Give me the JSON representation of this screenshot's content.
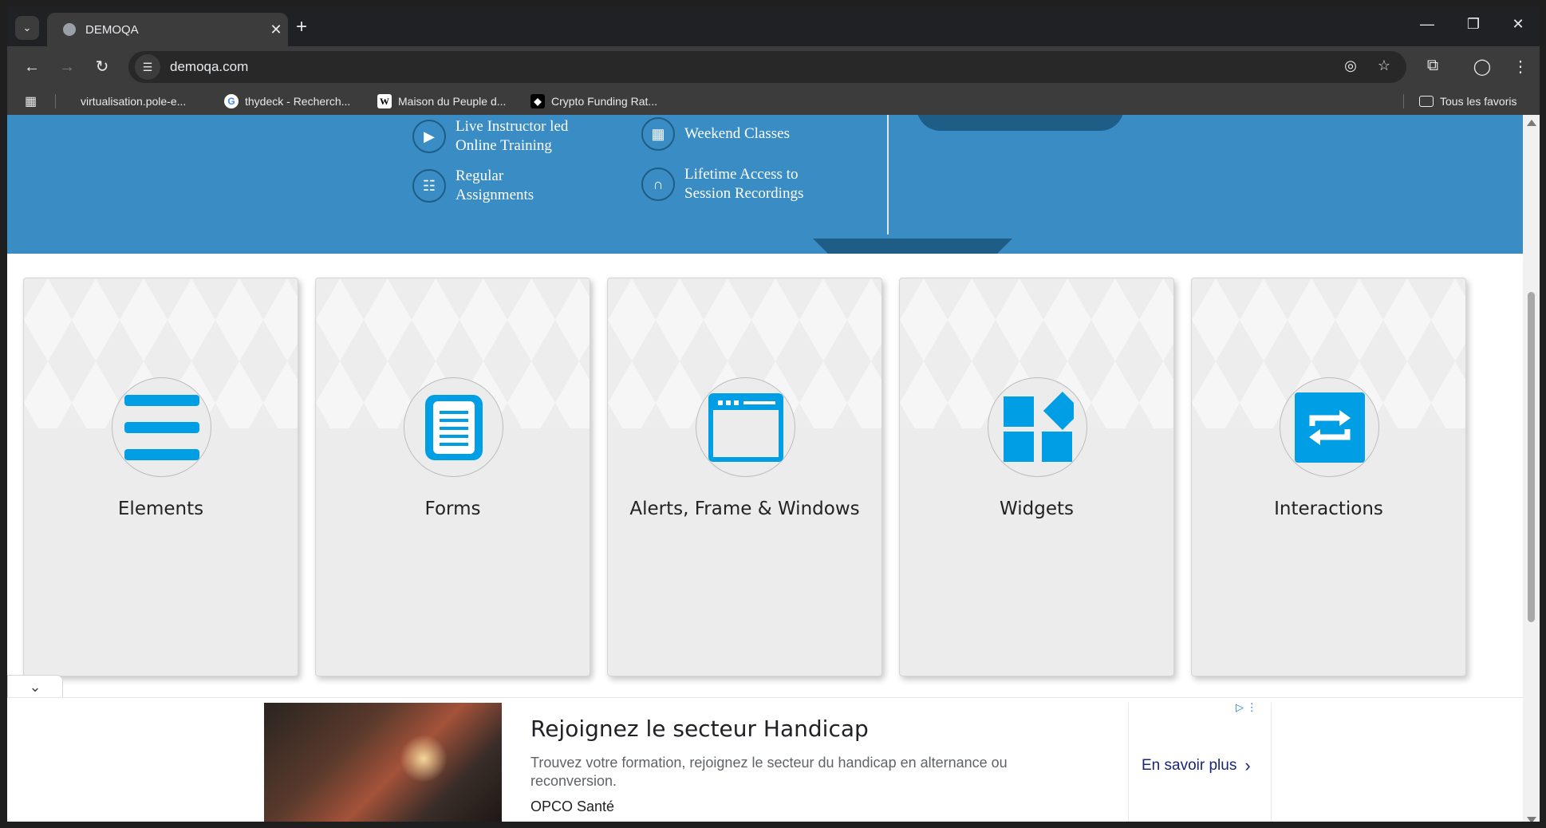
{
  "browser": {
    "tab_title": "DEMOQA",
    "url": "demoqa.com",
    "bookmarks": [
      {
        "label": "virtualisation.pole-e...",
        "icon": "blank-page-icon"
      },
      {
        "label": "thydeck - Recherch...",
        "icon": "google-icon"
      },
      {
        "label": "Maison du Peuple d...",
        "icon": "wikipedia-icon"
      },
      {
        "label": "Crypto Funding Rat...",
        "icon": "crypto-icon"
      }
    ],
    "all_bookmarks": "Tous les favoris"
  },
  "banner": {
    "features": [
      {
        "line1": "Live Instructor led",
        "line2": "Online Training",
        "icon": "play-icon"
      },
      {
        "line1": "Weekend Classes",
        "line2": "",
        "icon": "calendar-icon"
      },
      {
        "line1": "Regular",
        "line2": "Assignments",
        "icon": "document-icon"
      },
      {
        "line1": "Lifetime Access to",
        "line2": "Session Recordings",
        "icon": "headphones-icon"
      }
    ]
  },
  "cards": [
    {
      "label": "Elements",
      "icon": "hamburger-lines-icon"
    },
    {
      "label": "Forms",
      "icon": "form-document-icon"
    },
    {
      "label": "Alerts, Frame & Windows",
      "icon": "browser-window-icon"
    },
    {
      "label": "Widgets",
      "icon": "widgets-grid-icon"
    },
    {
      "label": "Interactions",
      "icon": "swap-arrows-icon"
    }
  ],
  "ad": {
    "headline": "Rejoignez le secteur Handicap",
    "description": "Trouvez votre formation, rejoignez le secteur du handicap en alternance ou reconversion.",
    "advertiser": "OPCO Santé",
    "cta": "En savoir plus"
  },
  "colors": {
    "accent": "#009ee5",
    "banner": "#3a8cc5",
    "banner_dark": "#1d5d86"
  }
}
